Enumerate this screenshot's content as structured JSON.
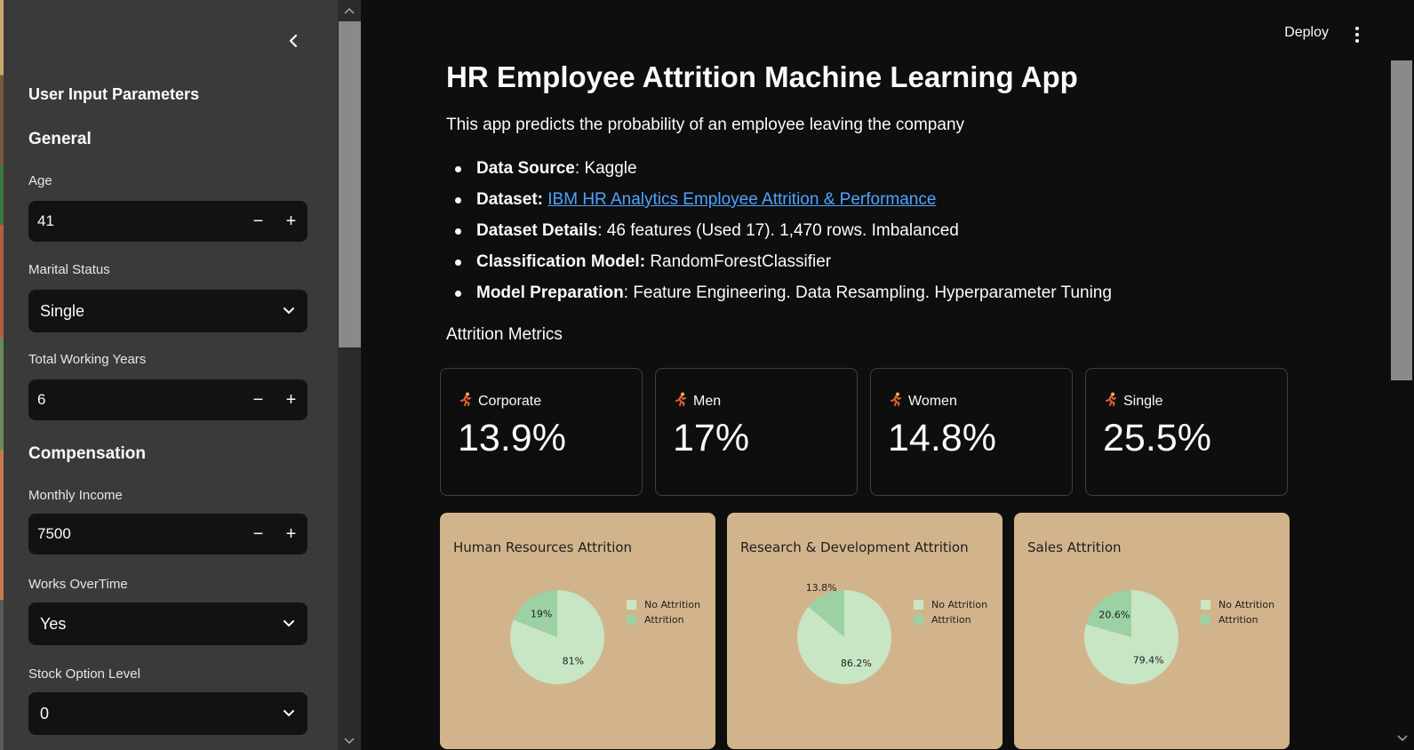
{
  "sidebar": {
    "title": "User Input Parameters",
    "sections": {
      "general": "General",
      "compensation": "Compensation"
    },
    "fields": {
      "age": {
        "label": "Age",
        "value": "41"
      },
      "marital_status": {
        "label": "Marital Status",
        "value": "Single"
      },
      "total_working_years": {
        "label": "Total Working Years",
        "value": "6"
      },
      "monthly_income": {
        "label": "Monthly Income",
        "value": "7500"
      },
      "works_overtime": {
        "label": "Works OverTime",
        "value": "Yes"
      },
      "stock_option_level": {
        "label": "Stock Option Level",
        "value": "0"
      }
    },
    "stepper": {
      "minus": "−",
      "plus": "+"
    }
  },
  "header": {
    "deploy_label": "Deploy"
  },
  "main": {
    "title": "HR Employee Attrition Machine Learning App",
    "description": "This app predicts the probability of an employee leaving the company",
    "bullets": [
      {
        "key": "Data Source",
        "sep": ": ",
        "text": "Kaggle",
        "link": ""
      },
      {
        "key": "Dataset:",
        "sep": " ",
        "text": "",
        "link": "IBM HR Analytics Employee Attrition & Performance"
      },
      {
        "key": "Dataset Details",
        "sep": ": ",
        "text": "46 features (Used 17). 1,470 rows. Imbalanced",
        "link": ""
      },
      {
        "key": "Classification Model:",
        "sep": " ",
        "text": "RandomForestClassifier",
        "link": ""
      },
      {
        "key": "Model Preparation",
        "sep": ": ",
        "text": "Feature Engineering. Data Resampling. Hyperparameter Tuning",
        "link": ""
      }
    ],
    "metrics_heading": "Attrition Metrics",
    "metrics": [
      {
        "label": "Corporate",
        "value": "13.9%"
      },
      {
        "label": "Men",
        "value": "17%"
      },
      {
        "label": "Women",
        "value": "14.8%"
      },
      {
        "label": "Single",
        "value": "25.5%"
      }
    ],
    "metric_icon": "running-person-icon"
  },
  "colors": {
    "card_bg": "#d2b48c",
    "no_attrition": "#c8e6c4",
    "attrition": "#9bd1a3",
    "link": "#4da3ff"
  },
  "chart_data": [
    {
      "type": "pie",
      "title": "Human Resources Attrition",
      "categories": [
        "No Attrition",
        "Attrition"
      ],
      "values": [
        81,
        19
      ],
      "labels": [
        "81%",
        "19%"
      ]
    },
    {
      "type": "pie",
      "title": "Research & Development Attrition",
      "categories": [
        "No Attrition",
        "Attrition"
      ],
      "values": [
        86.2,
        13.8
      ],
      "labels": [
        "86.2%",
        "13.8%"
      ]
    },
    {
      "type": "pie",
      "title": "Sales Attrition",
      "categories": [
        "No Attrition",
        "Attrition"
      ],
      "values": [
        79.4,
        20.6
      ],
      "labels": [
        "79.4%",
        "20.6%"
      ]
    }
  ]
}
